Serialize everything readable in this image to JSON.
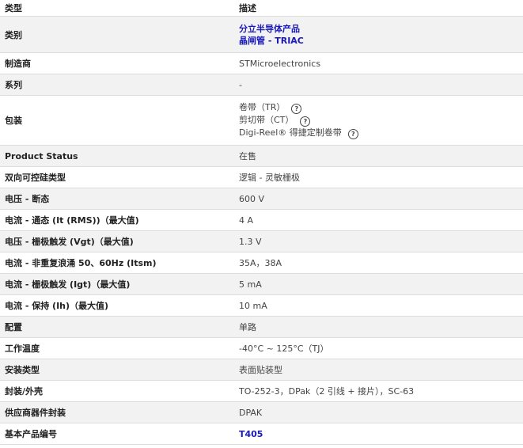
{
  "header": {
    "col1": "类型",
    "col2": "描述"
  },
  "rows": {
    "category": {
      "label": "类别",
      "links": [
        "分立半导体产品",
        "晶闸管 - TRIAC"
      ]
    },
    "manufacturer": {
      "label": "制造商",
      "value": "STMicroelectronics"
    },
    "series": {
      "label": "系列",
      "value": "-"
    },
    "packaging": {
      "label": "包装",
      "options": [
        "卷带（TR）",
        "剪切带（CT）",
        "Digi-Reel® 得捷定制卷带"
      ]
    },
    "product_status": {
      "label": "Product Status",
      "value": "在售"
    },
    "triac_type": {
      "label": "双向可控硅类型",
      "value": "逻辑 - 灵敏栅极"
    },
    "voltage_off": {
      "label": "电压 - 断态",
      "value": "600 V"
    },
    "current_on": {
      "label": "电流 - 通态 (It (RMS))（最大值)",
      "value": "4 A"
    },
    "voltage_gate": {
      "label": "电压 - 栅极触发 (Vgt)（最大值)",
      "value": "1.3 V"
    },
    "current_surge": {
      "label": "电流 - 非重复浪涌 50、60Hz (Itsm)",
      "value": "35A，38A"
    },
    "current_gate": {
      "label": "电流 - 栅极触发 (Igt)（最大值)",
      "value": "5 mA"
    },
    "current_hold": {
      "label": "电流 - 保持 (Ih)（最大值)",
      "value": "10 mA"
    },
    "configuration": {
      "label": "配置",
      "value": "单路"
    },
    "operating_temp": {
      "label": "工作温度",
      "value": "-40°C ~ 125°C（TJ）"
    },
    "mounting": {
      "label": "安装类型",
      "value": "表面贴装型"
    },
    "package_case": {
      "label": "封装/外壳",
      "value": "TO-252-3，DPak（2 引线 + 接片），SC-63"
    },
    "supplier_package": {
      "label": "供应商器件封装",
      "value": "DPAK"
    },
    "base_part": {
      "label": "基本产品编号",
      "value": "T405"
    }
  },
  "help_icon_glyph": "?"
}
